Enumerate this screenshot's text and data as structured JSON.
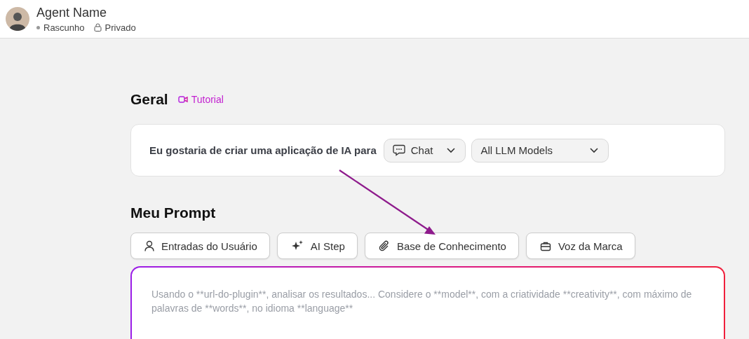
{
  "header": {
    "agent_name": "Agent Name",
    "status": "Rascunho",
    "visibility": "Privado"
  },
  "general": {
    "title": "Geral",
    "tutorial_link": "Tutorial",
    "sentence": "Eu gostaria de criar uma aplicação de IA para",
    "app_type": "Chat",
    "model": "All LLM Models"
  },
  "prompt": {
    "title": "Meu Prompt",
    "buttons": [
      {
        "kind": "user",
        "label": "Entradas do Usuário"
      },
      {
        "kind": "ai",
        "label": "AI Step"
      },
      {
        "kind": "knowledge",
        "label": "Base de Conhecimento"
      },
      {
        "kind": "brand",
        "label": "Voz da Marca"
      }
    ],
    "placeholder": "Usando o **url-do-plugin**, analisar os resultados... Considere o **model**, com a criatividade **creativity**, com máximo de palavras de **words**, no idioma **language**"
  }
}
